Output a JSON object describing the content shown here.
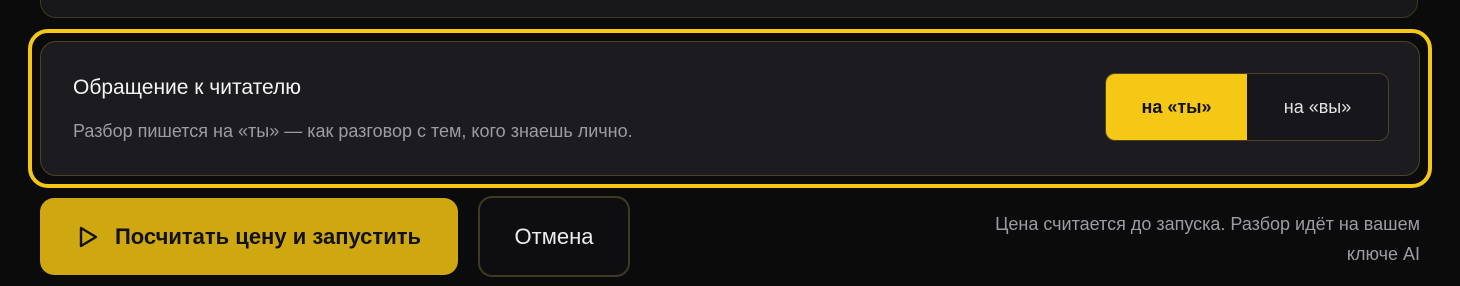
{
  "setting": {
    "title": "Обращение к читателю",
    "description": "Разбор пишется на «ты» — как разговор с тем, кого знаешь лично.",
    "options": [
      {
        "label": "на «ты»",
        "selected": true
      },
      {
        "label": "на «вы»",
        "selected": false
      }
    ]
  },
  "actions": {
    "primary_label": "Посчитать цену и запустить",
    "primary_icon": "play-icon",
    "cancel_label": "Отмена"
  },
  "hint": "Цена считается до запуска. Разбор идёт на вашем ключе AI",
  "colors": {
    "accent": "#f6c816",
    "primary_button": "#cfa711",
    "background": "#0b0b0c",
    "card": "#1b1b20"
  }
}
